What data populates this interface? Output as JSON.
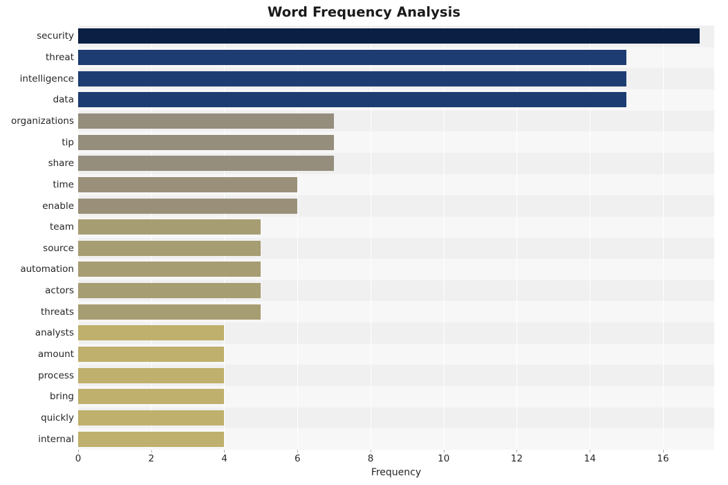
{
  "chart_data": {
    "type": "bar",
    "orientation": "horizontal",
    "title": "Word Frequency Analysis",
    "xlabel": "Frequency",
    "ylabel": "",
    "xlim": [
      0,
      17.4
    ],
    "xticks": [
      0,
      2,
      4,
      6,
      8,
      10,
      12,
      14,
      16
    ],
    "xticklabels": [
      "0",
      "2",
      "4",
      "6",
      "8",
      "10",
      "12",
      "14",
      "16"
    ],
    "grid": true,
    "legend": null,
    "categories": [
      "security",
      "threat",
      "intelligence",
      "data",
      "organizations",
      "tip",
      "share",
      "time",
      "enable",
      "team",
      "source",
      "automation",
      "actors",
      "threats",
      "analysts",
      "amount",
      "process",
      "bring",
      "quickly",
      "internal"
    ],
    "values": [
      17,
      15,
      15,
      15,
      7,
      7,
      7,
      6,
      6,
      5,
      5,
      5,
      5,
      5,
      4,
      4,
      4,
      4,
      4,
      4
    ],
    "bar_colors": [
      "#0b1f44",
      "#1d3c71",
      "#1d3c71",
      "#1d3c71",
      "#958e7d",
      "#958e7d",
      "#958e7d",
      "#9a9079",
      "#9a9079",
      "#a79d72",
      "#a79d72",
      "#a79d72",
      "#a79d72",
      "#a79d72",
      "#bfb06d",
      "#bfb06d",
      "#bfb06d",
      "#bfb06d",
      "#bfb06d",
      "#bfb06d"
    ],
    "plot_background": "#f7f7f7",
    "band_color": "#f0f0f0",
    "gridline_color": "#ffffff"
  }
}
